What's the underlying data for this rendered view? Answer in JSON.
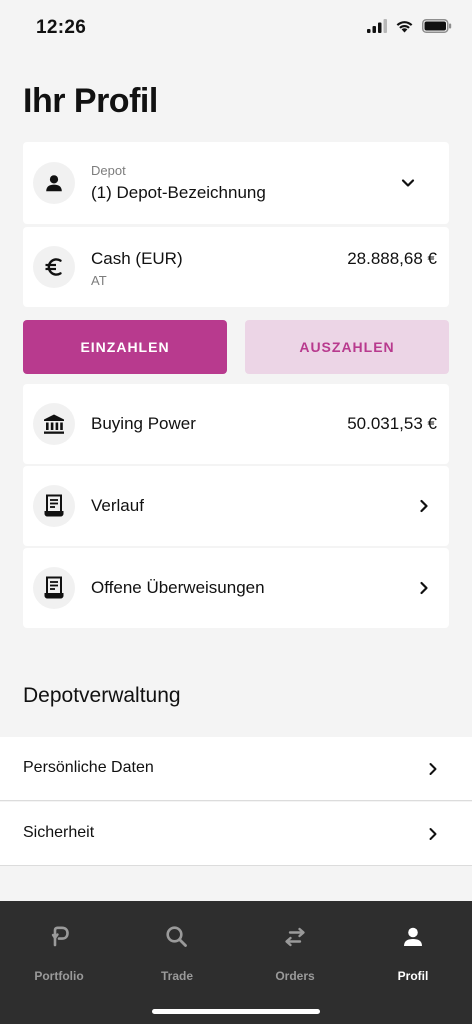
{
  "status": {
    "time": "12:26"
  },
  "page": {
    "title": "Ihr Profil"
  },
  "depot": {
    "label": "Depot",
    "name": "(1) Depot-Bezeichnung"
  },
  "cash": {
    "label": "Cash (EUR)",
    "sub": "AT",
    "value": "28.888,68 €"
  },
  "buttons": {
    "deposit": "EINZAHLEN",
    "withdraw": "AUSZAHLEN"
  },
  "buying_power": {
    "label": "Buying Power",
    "value": "50.031,53 €"
  },
  "history": {
    "label": "Verlauf"
  },
  "open_transfers": {
    "label": "Offene Überweisungen"
  },
  "management": {
    "title": "Depotverwaltung",
    "items": [
      {
        "label": "Persönliche Daten"
      },
      {
        "label": "Sicherheit"
      }
    ]
  },
  "nav": {
    "items": [
      {
        "label": "Portfolio",
        "icon": "portfolio-icon"
      },
      {
        "label": "Trade",
        "icon": "search-icon"
      },
      {
        "label": "Orders",
        "icon": "swap-icon"
      },
      {
        "label": "Profil",
        "icon": "person-icon"
      }
    ],
    "active": "Profil"
  },
  "colors": {
    "accent": "#b83a8e",
    "accent_light": "#ecd5e6",
    "background": "#f4f4f4",
    "nav_background": "#2e2e2e"
  }
}
